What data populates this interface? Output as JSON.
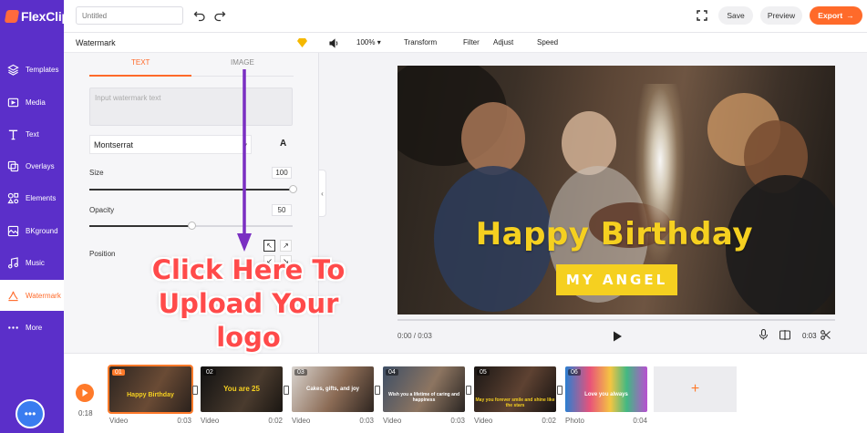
{
  "app": {
    "name": "FlexClip"
  },
  "sidebar": {
    "items": [
      {
        "label": "Templates",
        "icon": "layers-icon"
      },
      {
        "label": "Media",
        "icon": "media-icon"
      },
      {
        "label": "Text",
        "icon": "text-icon"
      },
      {
        "label": "Overlays",
        "icon": "overlays-icon"
      },
      {
        "label": "Elements",
        "icon": "elements-icon"
      },
      {
        "label": "BKground",
        "icon": "background-icon"
      },
      {
        "label": "Music",
        "icon": "music-icon"
      },
      {
        "label": "Watermark",
        "icon": "watermark-icon",
        "active": true
      },
      {
        "label": "More",
        "icon": "more-icon"
      }
    ],
    "chat_icon": "chat-icon"
  },
  "topbar": {
    "title_placeholder": "Untitled",
    "save_label": "Save",
    "preview_label": "Preview",
    "export_label": "Export"
  },
  "panel": {
    "title": "Watermark",
    "tabs": [
      {
        "label": "TEXT",
        "active": true
      },
      {
        "label": "IMAGE"
      }
    ],
    "text_placeholder": "Input watermark text",
    "font": "Montserrat",
    "font_style_glyph": "A",
    "size_label": "Size",
    "size_value": "100",
    "size_fraction": 1.0,
    "opacity_label": "Opacity",
    "opacity_value": "50",
    "opacity_fraction": 0.5,
    "position_label": "Position",
    "position_buttons": [
      "↖",
      "↗",
      "↙",
      "↘"
    ]
  },
  "annotation": {
    "lines": [
      "Click Here To",
      "Upload Your",
      "logo"
    ],
    "color": "#ff4a4a",
    "arrow_color": "#7a2fc2"
  },
  "toolbar": {
    "zoom": "100%",
    "items": [
      "Transform",
      "Filter",
      "Adjust",
      "Speed"
    ]
  },
  "canvas": {
    "headline": "Happy Birthday",
    "subtitle": "MY ANGEL",
    "accent": "#f5d020"
  },
  "player": {
    "current_time": "0:00 / 0:03",
    "duration": "0:03"
  },
  "timeline": {
    "elapsed": "0:18",
    "clips": [
      {
        "num": "01",
        "type": "Video",
        "duration": "0:03",
        "caption": "Happy Birthday",
        "selected": true
      },
      {
        "num": "02",
        "type": "Video",
        "duration": "0:02",
        "caption": "You are 25"
      },
      {
        "num": "03",
        "type": "Video",
        "duration": "0:03",
        "caption": "Cakes, gifts, and joy"
      },
      {
        "num": "04",
        "type": "Video",
        "duration": "0:03",
        "caption": "Wish you a lifetime of caring and happiness"
      },
      {
        "num": "05",
        "type": "Video",
        "duration": "0:02",
        "caption": "May you forever smile and shine like the stars"
      },
      {
        "num": "06",
        "type": "Photo",
        "duration": "0:04",
        "caption": "Love you always"
      }
    ],
    "add_label": "+"
  }
}
